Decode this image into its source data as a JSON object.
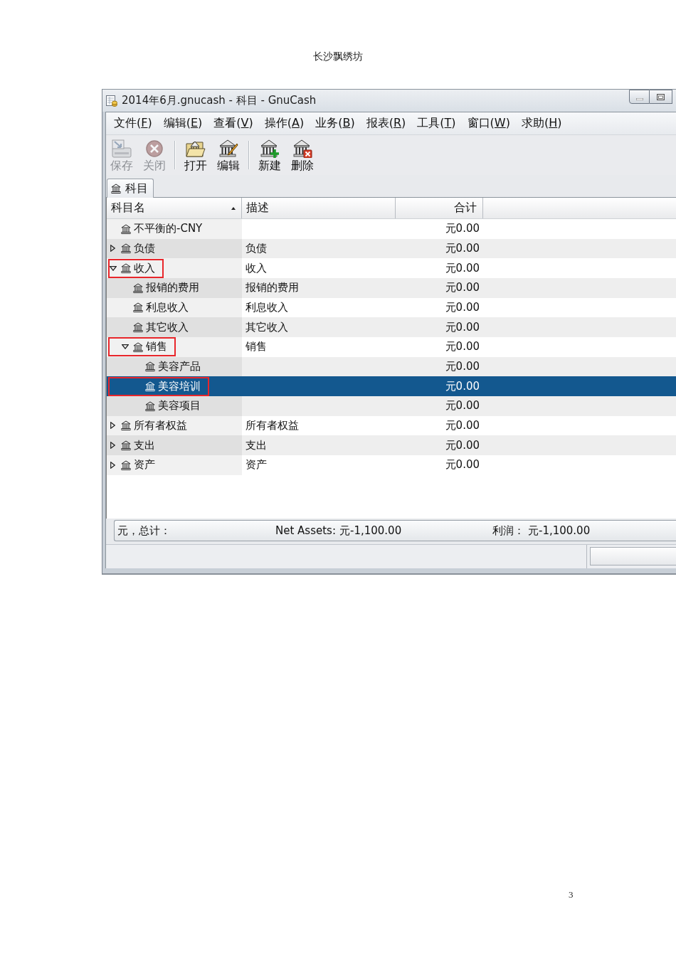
{
  "document": {
    "header": "长沙飘绣坊",
    "page_number": "3"
  },
  "window": {
    "title": "2014年6月.gnucash - 科目 - GnuCash"
  },
  "menu": [
    {
      "before": "文件(",
      "key": "F",
      "after": ")"
    },
    {
      "before": "编辑(",
      "key": "E",
      "after": ")"
    },
    {
      "before": "查看(",
      "key": "V",
      "after": ")"
    },
    {
      "before": "操作(",
      "key": "A",
      "after": ")"
    },
    {
      "before": "业务(",
      "key": "B",
      "after": ")"
    },
    {
      "before": "报表(",
      "key": "R",
      "after": ")"
    },
    {
      "before": "工具(",
      "key": "T",
      "after": ")"
    },
    {
      "before": "窗口(",
      "key": "W",
      "after": ")"
    },
    {
      "before": "求助(",
      "key": "H",
      "after": ")"
    }
  ],
  "toolbar": {
    "groups": [
      [
        {
          "kind": "save",
          "label": "保存",
          "disabled": true
        },
        {
          "kind": "close",
          "label": "关闭",
          "disabled": true
        }
      ],
      [
        {
          "kind": "open",
          "label": "打开",
          "disabled": false
        },
        {
          "kind": "edit",
          "label": "编辑",
          "disabled": false
        }
      ],
      [
        {
          "kind": "new",
          "label": "新建",
          "disabled": false
        },
        {
          "kind": "delete",
          "label": "删除",
          "disabled": false
        }
      ]
    ]
  },
  "tabs": [
    {
      "label": "科目",
      "selected": true
    }
  ],
  "tree": {
    "columns": [
      {
        "label": "科目名",
        "sorted": true
      },
      {
        "label": "描述",
        "sorted": false
      },
      {
        "label": "合计",
        "sorted": false
      }
    ],
    "accounts": [
      {
        "name": "不平衡的-CNY",
        "total": "元0.00",
        "selected": false,
        "annotated": false
      },
      {
        "name": "负债",
        "description": "负债",
        "total": "元0.00",
        "expanded": false,
        "selected": false,
        "annotated": false
      },
      {
        "name": "收入",
        "description": "收入",
        "total": "元0.00",
        "expanded": true,
        "selected": false,
        "annotated": true,
        "children": [
          {
            "name": "报销的费用",
            "description": "报销的费用",
            "total": "元0.00",
            "selected": false,
            "annotated": false
          },
          {
            "name": "利息收入",
            "description": "利息收入",
            "total": "元0.00",
            "selected": false,
            "annotated": false
          },
          {
            "name": "其它收入",
            "description": "其它收入",
            "total": "元0.00",
            "selected": false,
            "annotated": false
          },
          {
            "name": "销售",
            "description": "销售",
            "total": "元0.00",
            "expanded": true,
            "selected": false,
            "annotated": true,
            "children": [
              {
                "name": "美容产品",
                "total": "元0.00",
                "selected": false,
                "annotated": false
              },
              {
                "name": "美容培训",
                "total": "元0.00",
                "selected": true,
                "annotated": true
              },
              {
                "name": "美容项目",
                "total": "元0.00",
                "selected": false,
                "annotated": false
              }
            ]
          }
        ]
      },
      {
        "name": "所有者权益",
        "description": "所有者权益",
        "total": "元0.00",
        "expanded": false,
        "selected": false,
        "annotated": false
      },
      {
        "name": "支出",
        "description": "支出",
        "total": "元0.00",
        "expanded": false,
        "selected": false,
        "annotated": false
      },
      {
        "name": "资产",
        "description": "资产",
        "total": "元0.00",
        "expanded": false,
        "selected": false,
        "annotated": false
      }
    ]
  },
  "summary": {
    "label": "元，总计：",
    "items": [
      {
        "label": "Net Assets:",
        "value": "元-1,100.00"
      },
      {
        "label": "利润：",
        "value": "元-1,100.00"
      }
    ]
  }
}
